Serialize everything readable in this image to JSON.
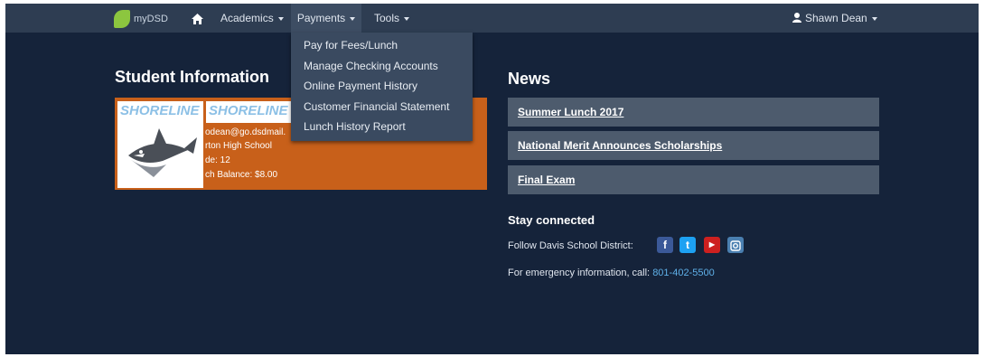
{
  "navbar": {
    "brand": "myDSD",
    "menus": [
      {
        "label": "Academics"
      },
      {
        "label": "Payments"
      },
      {
        "label": "Tools"
      }
    ],
    "user": "Shawn Dean"
  },
  "payments_dropdown": {
    "items": [
      "Pay for Fees/Lunch",
      "Manage Checking Accounts",
      "Online Payment History",
      "Customer Financial Statement",
      "Lunch History Report"
    ]
  },
  "student": {
    "heading": "Student Information",
    "logo_text": "SHORELINE",
    "email": "odean@go.dsdmail.",
    "school": "rton High School",
    "grade": "de: 12",
    "balance": "ch Balance: $8.00"
  },
  "news": {
    "heading": "News",
    "items": [
      "Summer Lunch 2017",
      "National Merit Announces Scholarships",
      "Final Exam"
    ]
  },
  "connect": {
    "heading": "Stay connected",
    "follow_text": "Follow Davis School District:",
    "social": [
      {
        "icon": "facebook-icon",
        "color": "#3b5998"
      },
      {
        "icon": "twitter-icon",
        "color": "#1da1f2"
      },
      {
        "icon": "youtube-icon",
        "color": "#cd201f"
      },
      {
        "icon": "instagram-icon",
        "color": "#4a7fb0"
      }
    ],
    "emergency_text": "For emergency information, call:",
    "emergency_phone": "801-402-5500"
  },
  "colors": {
    "background": "#15233a",
    "navbar": "#2e3d52",
    "card": "#c8601a",
    "news_item": "#4d5b6d",
    "link": "#5fb0e8"
  }
}
